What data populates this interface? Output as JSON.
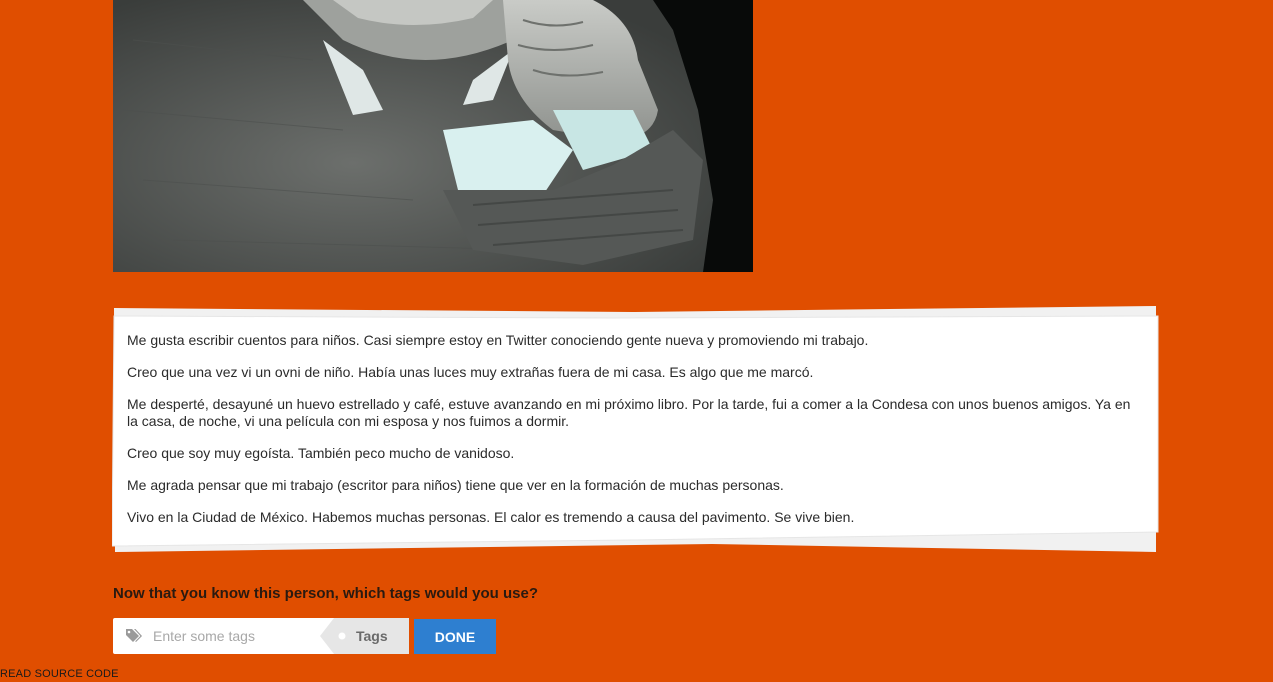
{
  "bio": {
    "paragraphs": [
      "Me gusta escribir cuentos para niños. Casi siempre estoy en Twitter conociendo gente nueva y promoviendo mi trabajo.",
      "Creo que una vez vi un ovni de niño. Había unas luces muy extrañas fuera de mi casa. Es algo que me marcó.",
      "Me desperté, desayuné un huevo estrellado y café, estuve avanzando en mi próximo libro. Por la tarde, fui a comer a la Condesa con unos buenos amigos. Ya en la casa, de noche, vi una película con mi esposa y nos fuimos a dormir.",
      "Creo que soy muy egoísta. También peco mucho de vanidoso.",
      "Me agrada pensar que mi trabajo (escritor para niños) tiene que ver en la formación de muchas personas.",
      "Vivo en la Ciudad de México. Habemos muchas personas. El calor es tremendo a causa del pavimento. Se vive bien."
    ]
  },
  "tagging": {
    "question": "Now that you know this person, which tags would you use?",
    "input_placeholder": "Enter some tags",
    "input_value": "",
    "tag_label": "Tags",
    "done_label": "DONE"
  },
  "footer": {
    "source_link": "READ SOURCE CODE"
  },
  "colors": {
    "background": "#e04e00",
    "done_button": "#2e7fd0",
    "card": "#ffffff"
  },
  "icons": {
    "tags": "tags-icon"
  }
}
